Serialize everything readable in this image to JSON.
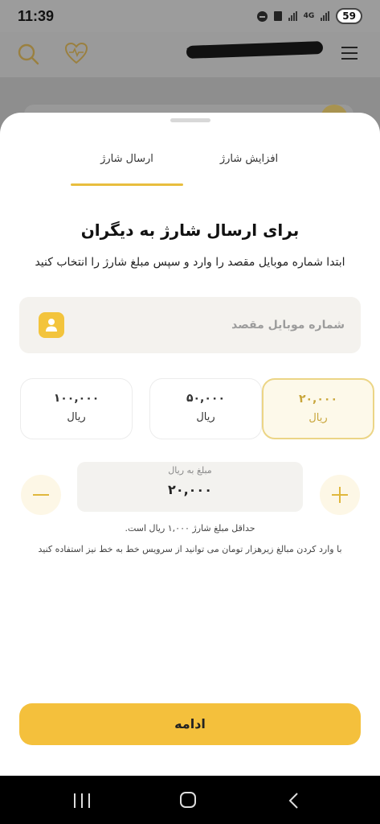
{
  "status_bar": {
    "time": "11:39",
    "network": "4G",
    "battery": "59"
  },
  "header": {
    "icons": [
      "search-icon",
      "heart-icon",
      "menu-icon"
    ]
  },
  "sheet": {
    "tabs": [
      {
        "label": "افزایش شارژ",
        "active": false
      },
      {
        "label": "ارسال شارژ",
        "active": true
      }
    ],
    "title": "برای ارسال شارژ به دیگران",
    "subtitle": "ابتدا شماره موبایل مقصد را وارد و سپس مبلغ شارژ را انتخاب کنید",
    "phone_field": {
      "placeholder": "شماره موبایل مقصد",
      "value": ""
    },
    "amount_options": [
      {
        "value": "۲۰,۰۰۰",
        "unit": "ریال",
        "selected": true
      },
      {
        "value": "۵۰,۰۰۰",
        "unit": "ریال",
        "selected": false
      },
      {
        "value": "۱۰۰,۰۰۰",
        "unit": "ریال",
        "selected": false
      }
    ],
    "amount": {
      "label": "مبلغ به ریال",
      "value": "۲۰,۰۰۰"
    },
    "min_note": "حداقل مبلغ شارژ ۱,۰۰۰ ریال است.",
    "service_note": "با وارد کردن مبالغ زیرهزار تومان می توانید از سرویس خط به خط نیز استفاده کنید",
    "continue_label": "ادامه"
  },
  "colors": {
    "accent": "#f4c03c",
    "accent_light": "#fdf9ea",
    "accent_border": "#ecd586"
  }
}
